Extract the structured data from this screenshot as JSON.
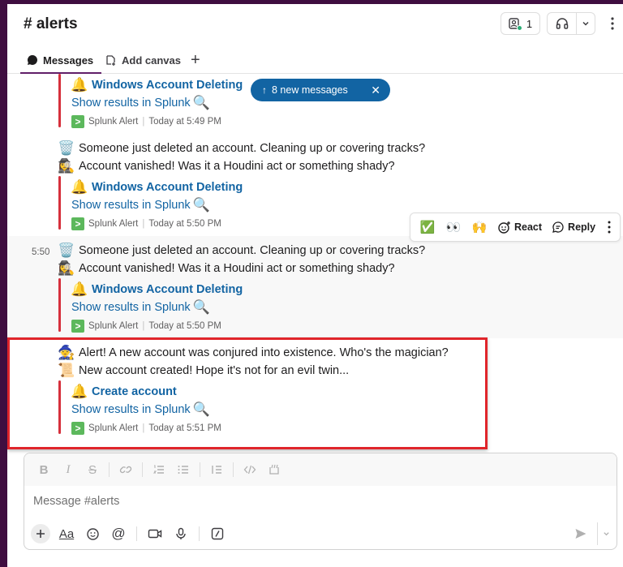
{
  "channel": {
    "title": "# alerts"
  },
  "header": {
    "member_count": "1"
  },
  "tabs": {
    "messages": "Messages",
    "canvas": "Add canvas",
    "add": "+"
  },
  "new_messages_pill": {
    "label": "8 new messages"
  },
  "messages": [
    {
      "attachment_title": "Windows Account Deleting",
      "link": "Show results in Splunk",
      "app": "Splunk Alert",
      "time": "Today at 5:49 PM"
    },
    {
      "lines": [
        {
          "emoji": "🗑️",
          "text": "Someone just deleted an account. Cleaning up or covering tracks?"
        },
        {
          "emoji": "🕵️‍♀️",
          "text": "Account vanished! Was it a Houdini act or something shady?"
        }
      ],
      "attachment_title": "Windows Account Deleting",
      "link": "Show results in Splunk",
      "app": "Splunk Alert",
      "time": "Today at 5:50 PM"
    },
    {
      "timestamp": "5:50",
      "lines": [
        {
          "emoji": "🗑️",
          "text": "Someone just deleted an account. Cleaning up or covering tracks?"
        },
        {
          "emoji": "🕵️‍♀️",
          "text": "Account vanished! Was it a Houdini act or something shady?"
        }
      ],
      "attachment_title": "Windows Account Deleting",
      "link": "Show results in Splunk",
      "app": "Splunk Alert",
      "time": "Today at 5:50 PM"
    },
    {
      "lines": [
        {
          "emoji": "🧙",
          "text": "Alert! A new account was conjured into existence. Who's the magician?"
        },
        {
          "emoji": "📜",
          "text": "New account created! Hope it's not for an evil twin..."
        }
      ],
      "attachment_title": "Create account",
      "link": "Show results in Splunk",
      "app": "Splunk Alert",
      "time": "Today at 5:51 PM"
    }
  ],
  "hover_toolbar": {
    "reaction_1": "✅",
    "reaction_2": "👀",
    "reaction_3": "🙌",
    "react_label": "React",
    "reply_label": "Reply"
  },
  "composer": {
    "placeholder": "Message #alerts"
  },
  "colors": {
    "accent_link": "#1264a3",
    "alert_bar": "#d6303c",
    "highlight": "#e0252b",
    "sidebar": "#3f0e40"
  }
}
